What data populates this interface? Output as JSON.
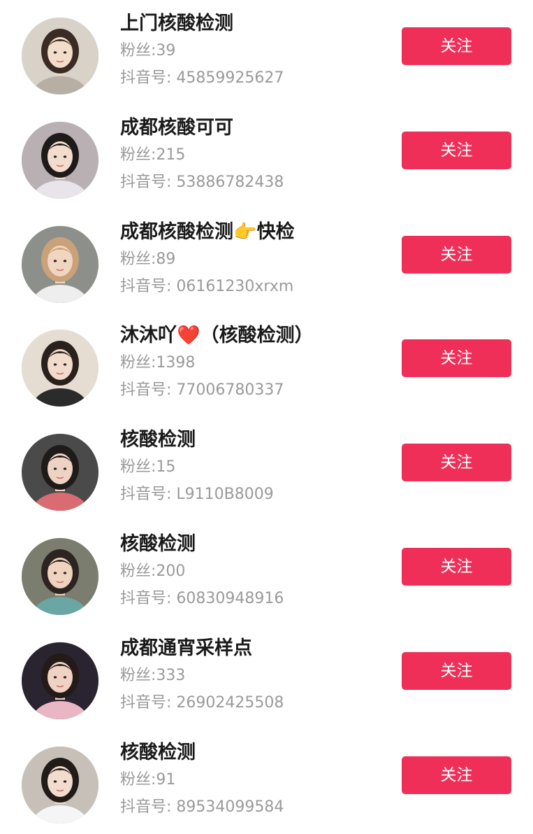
{
  "accounts": [
    {
      "name": "上门核酸检测",
      "fans": "粉丝:39",
      "account_id": "抖音号: 45859925627",
      "follow_label": "关注",
      "avatar": {
        "bg": "#d9d2c8",
        "skin": "#f3dcc9",
        "hair": "#3a2c24",
        "accent": "#b7aea4"
      }
    },
    {
      "name": "成都核酸可可",
      "fans": "粉丝:215",
      "account_id": "抖音号: 53886782438",
      "follow_label": "关注",
      "avatar": {
        "bg": "#b9b0b4",
        "skin": "#f2dccc",
        "hair": "#1e1a1a",
        "accent": "#e9e4ea"
      }
    },
    {
      "name": "成都核酸检测👉快检",
      "fans": "粉丝:89",
      "account_id": "抖音号: 06161230xrxm",
      "follow_label": "关注",
      "avatar": {
        "bg": "#8c8f8a",
        "skin": "#f0d6c0",
        "hair": "#c9a27a",
        "accent": "#eeeeee"
      }
    },
    {
      "name": "沐沐吖❤️（核酸检测）",
      "fans": "粉丝:1398",
      "account_id": "抖音号: 77006780337",
      "follow_label": "关注",
      "avatar": {
        "bg": "#e6ddd2",
        "skin": "#f1dccb",
        "hair": "#2a211c",
        "accent": "#2b2b2b"
      }
    },
    {
      "name": "核酸检测",
      "fans": "粉丝:15",
      "account_id": "抖音号: L9110B8009",
      "follow_label": "关注",
      "avatar": {
        "bg": "#4b4a4a",
        "skin": "#eed3c4",
        "hair": "#1f1b19",
        "accent": "#d96b73"
      }
    },
    {
      "name": "核酸检测",
      "fans": "粉丝:200",
      "account_id": "抖音号: 60830948916",
      "follow_label": "关注",
      "avatar": {
        "bg": "#7b7d6e",
        "skin": "#efd3bf",
        "hair": "#2c2420",
        "accent": "#6aa7a4"
      }
    },
    {
      "name": "成都通宵采样点",
      "fans": "粉丝:333",
      "account_id": "抖音号: 26902425508",
      "follow_label": "关注",
      "avatar": {
        "bg": "#2a2330",
        "skin": "#f0d2c4",
        "hair": "#241a18",
        "accent": "#e9b7c4"
      }
    },
    {
      "name": "核酸检测",
      "fans": "粉丝:91",
      "account_id": "抖音号: 89534099584",
      "follow_label": "关注",
      "avatar": {
        "bg": "#c7c0b9",
        "skin": "#f2dccd",
        "hair": "#221c19",
        "accent": "#f5f5f5"
      }
    }
  ]
}
